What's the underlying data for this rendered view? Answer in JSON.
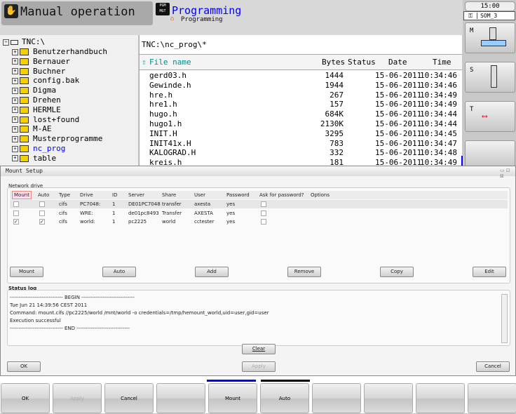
{
  "header": {
    "mode": "Manual operation",
    "mode_icon": "hand-icon",
    "prog_mode": "Programming",
    "prog_sub": "Programming",
    "prog_icon": "pgm-mgt-icon"
  },
  "side": {
    "time": "15:00",
    "user": "SOM_3",
    "softkeys": [
      {
        "label": "M"
      },
      {
        "label": "S"
      },
      {
        "label": "T"
      },
      {
        "label": ""
      }
    ]
  },
  "tree": {
    "root": "TNC:\\",
    "items": [
      "Benutzerhandbuch",
      "Bernauer",
      "Buchner",
      "config.bak",
      "Digma",
      "Drehen",
      "HERMLE",
      "lost+found",
      "M-AE",
      "Musterprogramme",
      "nc_prog",
      "table"
    ],
    "selected": "nc_prog"
  },
  "files": {
    "path": "TNC:\\nc_prog\\*",
    "columns": [
      "File name",
      "Bytes",
      "Status",
      "Date",
      "Time"
    ],
    "rows": [
      [
        "gerd03.h",
        "1444",
        "",
        "15-06-2011",
        "10:34:46"
      ],
      [
        "Gewinde.h",
        "1944",
        "",
        "15-06-2011",
        "10:34:46"
      ],
      [
        "hre.h",
        "267",
        "",
        "15-06-2011",
        "10:34:49"
      ],
      [
        "hre1.h",
        "157",
        "",
        "15-06-2011",
        "10:34:49"
      ],
      [
        "hugo.h",
        "684K",
        "",
        "15-06-2011",
        "10:34:44"
      ],
      [
        "hugo1.h",
        "2130K",
        "",
        "15-06-2011",
        "10:34:44"
      ],
      [
        "INIT.H",
        "3295",
        "",
        "15-06-2011",
        "10:34:45"
      ],
      [
        "INIT41x.H",
        "783",
        "",
        "15-06-2011",
        "10:34:47"
      ],
      [
        "KALOGRAD.H",
        "332",
        "",
        "15-06-2011",
        "10:34:48"
      ],
      [
        "kreis.h",
        "181",
        "",
        "15-06-2011",
        "10:34:49"
      ]
    ]
  },
  "dialog": {
    "title": "Mount Setup",
    "group": "Network drive",
    "columns": [
      "Mount",
      "Auto",
      "Type",
      "Drive",
      "ID",
      "Server",
      "Share",
      "User",
      "Password",
      "Ask for password?",
      "Options"
    ],
    "rows": [
      {
        "mount": false,
        "auto": false,
        "type": "cifs",
        "drive": "PC7048:",
        "id": "1",
        "server": "DE01PC7048",
        "share": "transfer",
        "user": "axesta",
        "password": "yes",
        "ask": false
      },
      {
        "mount": false,
        "auto": false,
        "type": "cifs",
        "drive": "WRE:",
        "id": "1",
        "server": "de01pc8493",
        "share": "Transfer",
        "user": "AXESTA",
        "password": "yes",
        "ask": false
      },
      {
        "mount": true,
        "auto": true,
        "type": "cifs",
        "drive": "world:",
        "id": "1",
        "server": "pc2225",
        "share": "world",
        "user": "cctester",
        "password": "yes",
        "ask": false
      }
    ],
    "buttons": [
      "Mount",
      "Auto",
      "Add",
      "Remove",
      "Copy",
      "Edit"
    ],
    "log_title": "Status log",
    "log": [
      "------------------------------ BEGIN ------------------------------",
      "Tue Jun 21 14:39:56 CEST 2011",
      "Command: mount.cifs //pc2225/world /mnt/world -o credentials=/tmp/hemount_world,uid=user,gid=user",
      "Execution successful",
      "------------------------------ END ------------------------------"
    ],
    "clear": "Clear",
    "ok": "OK",
    "apply": "Apply",
    "cancel": "Cancel"
  },
  "softkeys": [
    "OK",
    "Apply",
    "Cancel",
    "",
    "Mount",
    "Auto",
    "",
    "",
    "",
    ""
  ],
  "colors": {
    "accent": "#0000ff",
    "folder": "#f4d000",
    "file_header": "#008b8b"
  }
}
